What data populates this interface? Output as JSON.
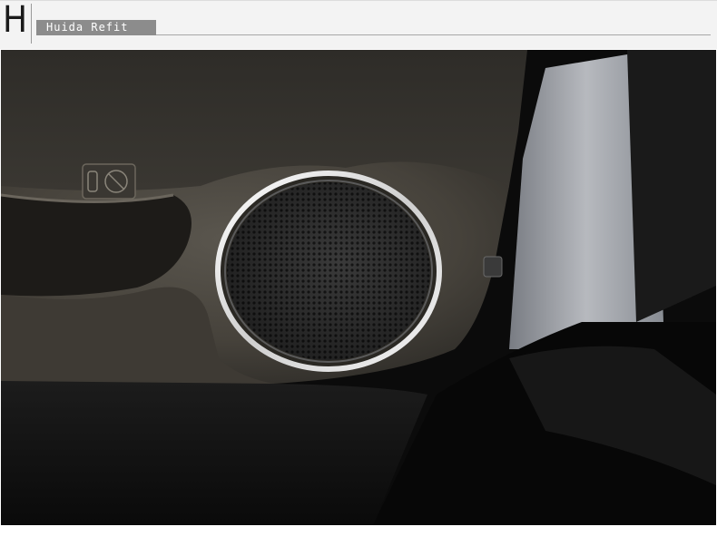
{
  "header": {
    "letter": "H",
    "brand_label": "Huida Refit"
  },
  "photo": {
    "subject_icons": [
      "bottle-holder-icon",
      "no-cup-icon"
    ],
    "colors": {
      "door_panel": "#4b4740",
      "speaker_ring": "#e8e8e8",
      "speaker_mesh": "#2a2a2a",
      "floor_carpet": "#141414",
      "door_opening": "#c7cbd2"
    }
  }
}
